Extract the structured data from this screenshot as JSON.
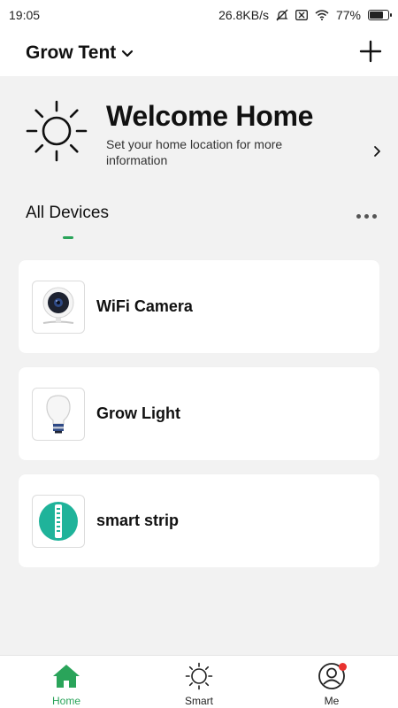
{
  "status_bar": {
    "time": "19:05",
    "network_speed": "26.8KB/s",
    "battery": "77%",
    "battery_level": 0.77
  },
  "header": {
    "home_name": "Grow Tent",
    "dropdown_icon": "chevron-down-icon",
    "add_icon": "plus-icon"
  },
  "welcome": {
    "title": "Welcome Home",
    "subtitle": "Set your home location for more information",
    "icon": "sun-icon"
  },
  "devices_section": {
    "title": "All Devices",
    "more_icon": "more-dots-icon"
  },
  "devices": [
    {
      "name": "WiFi Camera",
      "icon": "camera-icon"
    },
    {
      "name": "Grow Light",
      "icon": "bulb-icon"
    },
    {
      "name": "smart strip",
      "icon": "power-strip-icon"
    }
  ],
  "tabs": [
    {
      "label": "Home",
      "icon": "home-icon",
      "active": true
    },
    {
      "label": "Smart",
      "icon": "sun-icon",
      "active": false
    },
    {
      "label": "Me",
      "icon": "user-icon",
      "active": false,
      "notification": true
    }
  ],
  "colors": {
    "accent": "#2aa45a",
    "background": "#f2f2f2",
    "card": "#ffffff",
    "badge": "#e8322f",
    "strip_teal": "#1fb39a"
  }
}
